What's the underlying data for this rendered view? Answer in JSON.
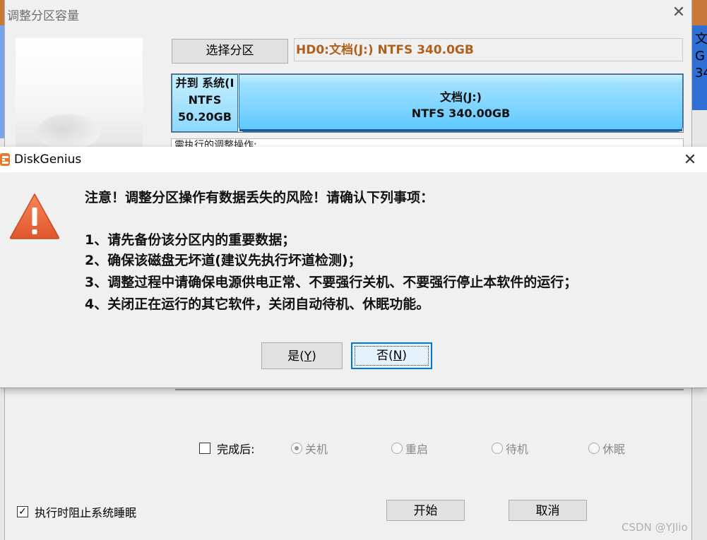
{
  "background_window": {
    "right_edge_text": "文\nG\n34"
  },
  "resize_dialog": {
    "title": "调整分区容量",
    "select_partition_button": "选择分区",
    "partition_field": "HD0:文档(J:) NTFS 340.0GB",
    "segment_system": {
      "name": "并到 系统(I",
      "fs": "NTFS",
      "size": "50.20GB"
    },
    "segment_docs": {
      "name": "文档(J:)",
      "fs_size": "NTFS 340.00GB"
    },
    "ops_label": "需执行的调整操作:",
    "after_complete_label": "完成后:",
    "after_options": [
      "关机",
      "重启",
      "待机",
      "休眠"
    ],
    "after_selected": "关机",
    "prevent_sleep_label": "执行时阻止系统睡眠",
    "start_button": "开始",
    "cancel_button": "取消"
  },
  "alert": {
    "title": "DiskGenius",
    "heading": "注意！调整分区操作有数据丢失的风险！请确认下列事项：",
    "items": [
      "1、请先备份该分区内的重要数据；",
      "2、确保该磁盘无坏道(建议先执行坏道检测)；",
      "3、调整过程中请确保电源供电正常、不要强行关机、不要强行停止本软件的运行；",
      "4、关闭正在运行的其它软件，关闭自动待机、休眠功能。"
    ],
    "yes_label_main": "是(",
    "yes_mnemonic": "Y",
    "yes_label_end": ")",
    "no_label_main": "否(",
    "no_mnemonic": "N",
    "no_label_end": ")"
  },
  "watermark": "CSDN @YJlio",
  "colors": {
    "accent_orange": "#b0601a",
    "focus_blue": "#0078d7",
    "warning_orange": "#e8603a"
  }
}
